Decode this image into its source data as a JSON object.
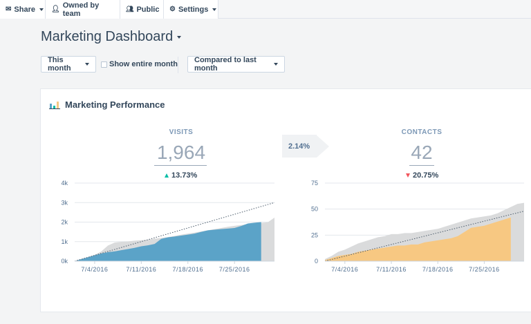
{
  "toolbar": {
    "share": "Share",
    "owned": "Owned by team",
    "public": "Public",
    "settings": "Settings"
  },
  "dashboard": {
    "title": "Marketing Dashboard"
  },
  "filters": {
    "date_range": "This month",
    "show_entire_month": "Show entire month",
    "compare": "Compared to last month"
  },
  "card": {
    "title": "Marketing Performance",
    "conversion_rate": "2.14%"
  },
  "visits": {
    "label": "VISITS",
    "value": "1,964",
    "change": "13.73%",
    "direction": "up"
  },
  "contacts": {
    "label": "CONTACTS",
    "value": "42",
    "change": "20.75%",
    "direction": "down"
  },
  "colors": {
    "visits_fill": "#5ba3c8",
    "contacts_fill": "#f7c882",
    "previous_fill": "#dadbdc",
    "up": "#00bda5",
    "down": "#f2545b",
    "text": "#33475b"
  },
  "chart_data": [
    {
      "type": "area",
      "title": "VISITS",
      "x_ticks": [
        "7/4/2016",
        "7/11/2016",
        "7/18/2016",
        "7/25/2016"
      ],
      "y_ticks": [
        "0k",
        "1k",
        "2k",
        "3k",
        "4k"
      ],
      "ylim": [
        0,
        4000
      ],
      "days": 31,
      "series": [
        {
          "values": [
            0,
            100,
            200,
            300,
            390,
            460,
            500,
            560,
            620,
            680,
            760,
            810,
            880,
            1140,
            1220,
            1260,
            1310,
            1360,
            1410,
            1500,
            1580,
            1610,
            1640,
            1670,
            1700,
            1800,
            1930,
            1970,
            2000
          ]
        },
        {
          "values": [
            0,
            100,
            200,
            320,
            500,
            800,
            950,
            990,
            1010,
            1050,
            1070,
            1100,
            1150,
            1190,
            1230,
            1290,
            1360,
            1410,
            1460,
            1520,
            1580,
            1640,
            1700,
            1760,
            1810,
            1850,
            1890,
            1920,
            1960,
            1990,
            2230
          ]
        },
        {
          "values": [
            0,
            100,
            200,
            300,
            400,
            500,
            600,
            700,
            800,
            900,
            1000,
            1100,
            1200,
            1300,
            1400,
            1500,
            1600,
            1700,
            1800,
            1900,
            2000,
            2100,
            2200,
            2300,
            2400,
            2500,
            2600,
            2700,
            2800,
            2900,
            3000
          ]
        }
      ]
    },
    {
      "type": "area",
      "title": "CONTACTS",
      "x_ticks": [
        "7/4/2016",
        "7/11/2016",
        "7/18/2016",
        "7/25/2016"
      ],
      "y_ticks": [
        "0",
        "25",
        "50",
        "75"
      ],
      "ylim": [
        0,
        75
      ],
      "days": 31,
      "series": [
        {
          "values": [
            1,
            3,
            5,
            6,
            7,
            9,
            10,
            11,
            12,
            13,
            14,
            15,
            15,
            16,
            16,
            18,
            19,
            20,
            21,
            22,
            24,
            28,
            32,
            33,
            34,
            36,
            38,
            40,
            42
          ]
        },
        {
          "values": [
            2,
            5,
            9,
            11,
            14,
            17,
            19,
            21,
            23,
            24,
            26,
            26,
            27,
            27,
            28,
            29,
            30,
            31,
            33,
            35,
            37,
            39,
            41,
            42,
            43,
            44,
            46,
            49,
            52,
            55,
            56
          ]
        },
        {
          "values": [
            0,
            1.6,
            3.2,
            4.8,
            6.4,
            8,
            9.6,
            11.2,
            12.8,
            14.4,
            16,
            17.6,
            19.2,
            20.8,
            22.4,
            24,
            25.6,
            27.2,
            28.8,
            30.4,
            32,
            33.6,
            35.2,
            36.8,
            38.4,
            40,
            41.6,
            43.2,
            44.8,
            46.4,
            48
          ]
        }
      ]
    }
  ]
}
